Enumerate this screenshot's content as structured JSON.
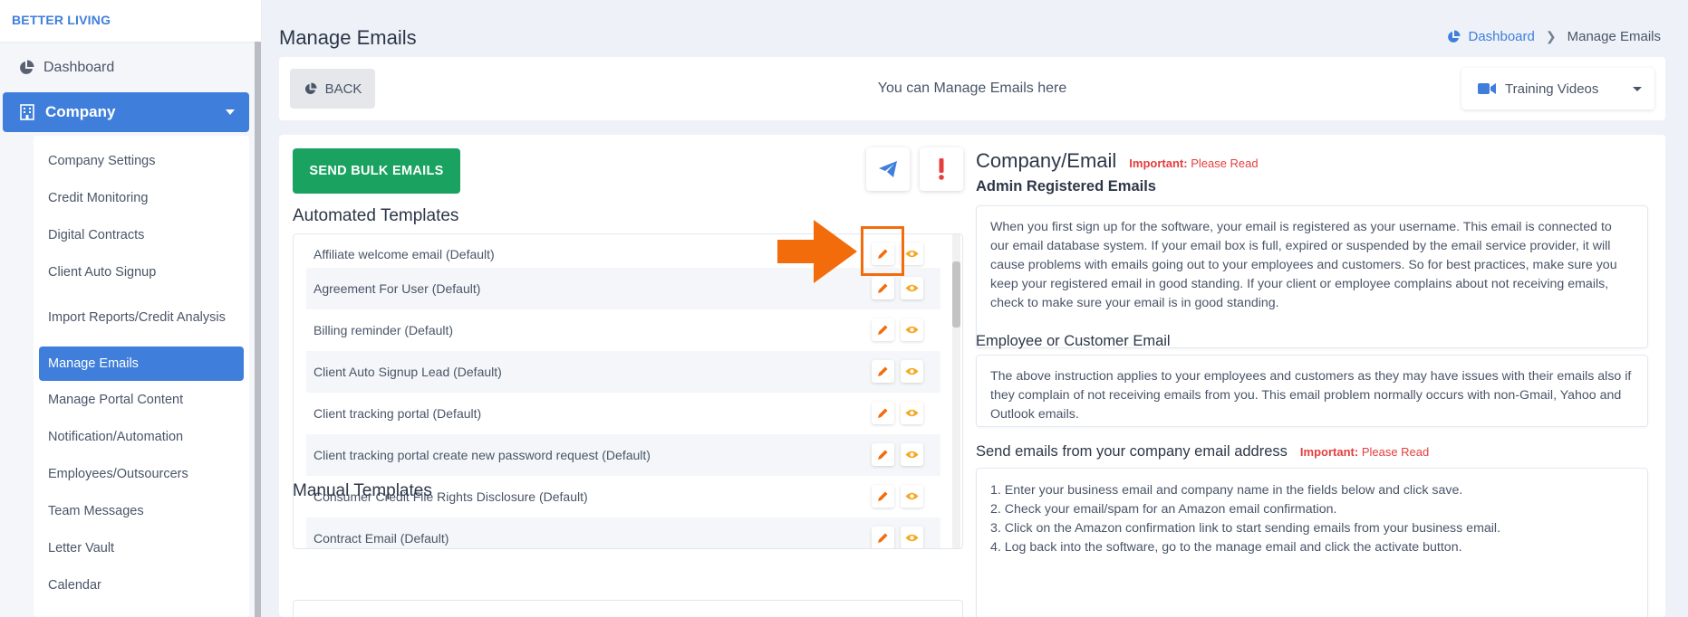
{
  "brand": "BETTER LIVING",
  "sidebar": {
    "dashboard": "Dashboard",
    "company": "Company",
    "items": [
      {
        "label": "Company Settings",
        "active": false
      },
      {
        "label": "Credit Monitoring",
        "active": false
      },
      {
        "label": "Digital Contracts",
        "active": false
      },
      {
        "label": "Client Auto Signup",
        "active": false
      },
      {
        "label": "Import Reports/Credit Analysis",
        "active": false
      },
      {
        "label": "Manage Emails",
        "active": true
      },
      {
        "label": "Manage Portal Content",
        "active": false
      },
      {
        "label": "Notification/Automation",
        "active": false
      },
      {
        "label": "Employees/Outsourcers",
        "active": false
      },
      {
        "label": "Team Messages",
        "active": false
      },
      {
        "label": "Letter Vault",
        "active": false
      },
      {
        "label": "Calendar",
        "active": false
      }
    ]
  },
  "header": {
    "title": "Manage Emails",
    "breadcrumb": [
      "Dashboard",
      "Manage Emails"
    ]
  },
  "topbar": {
    "back": "BACK",
    "message": "You can Manage Emails here",
    "training": "Training Videos"
  },
  "main": {
    "bulk_button": "SEND BULK EMAILS",
    "automated_title": "Automated Templates",
    "manual_title": "Manual Templates",
    "templates": [
      "Affiliate welcome email (Default)",
      "Agreement For User (Default)",
      "Billing reminder (Default)",
      "Client Auto Signup Lead (Default)",
      "Client tracking portal (Default)",
      "Client tracking portal create new password request (Default)",
      "Consumer Credit File Rights Disclosure (Default)",
      "Contract Email (Default)"
    ]
  },
  "right": {
    "title": "Company/Email",
    "important_label": "Important:",
    "important_link": "Please Read",
    "admin_title": "Admin Registered Emails",
    "admin_text": "When you first sign up for the software, your email is registered as your username. This email is connected to our email database system. If your email box is full, expired or suspended by the email service provider, it will cause problems with emails going out to your employees and customers. So for best practices, make sure you keep your registered email in good standing. If your client or employee complains about not receiving emails, check to make sure your email is in good standing.",
    "employee_title": "Employee or Customer Email",
    "employee_text": "The above instruction applies to your employees and customers as they may have issues with their emails also if they complain of not receiving emails from you. This email problem normally occurs with non-Gmail, Yahoo and Outlook emails.",
    "send_title": "Send emails from your company email address",
    "steps": [
      "1. Enter your business email and company name in the fields below and click save.",
      "2. Check your email/spam for an Amazon email confirmation.",
      "3. Click on the Amazon confirmation link to start sending emails from your business email.",
      "4. Log back into the software, go to the manage email and click the activate button."
    ]
  },
  "colors": {
    "primary": "#3f7fdb",
    "success": "#1aa260",
    "danger": "#e53e3e",
    "edit_icon": "#f36c0c",
    "view_icon": "#f6a821",
    "highlight": "#f36c0c"
  }
}
